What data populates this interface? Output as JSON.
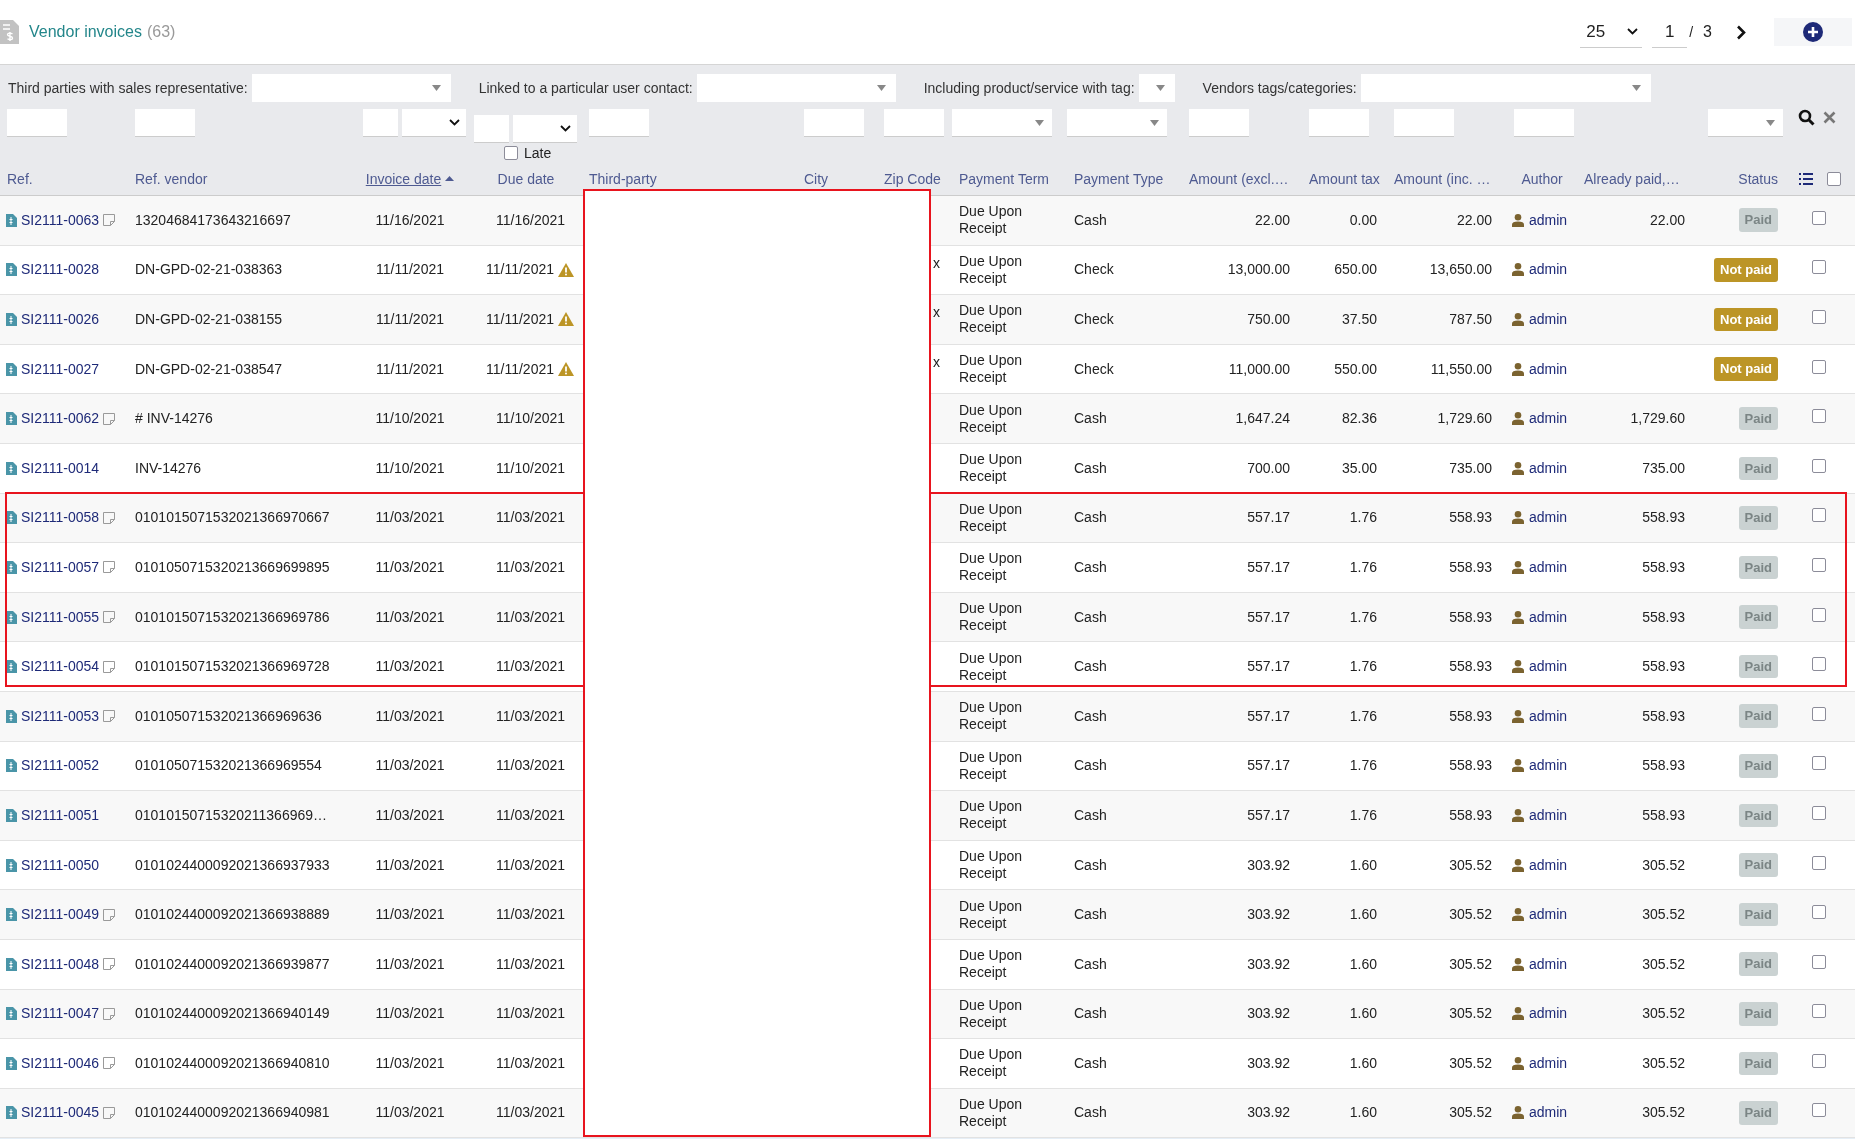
{
  "header": {
    "title": "Vendor invoices",
    "count": "(63)",
    "page_size": "25",
    "page": "1",
    "page_separator": "/",
    "page_total": "3"
  },
  "filters": [
    {
      "label": "Third parties with sales representative:",
      "kind": "wide"
    },
    {
      "label": "Linked to a particular user contact:",
      "kind": "wide"
    },
    {
      "label": "Including product/service with tag:",
      "kind": "narrow"
    },
    {
      "label": "Vendors tags/categories:",
      "kind": "xwide"
    }
  ],
  "column_filters": [
    {
      "kind": "text"
    },
    {
      "kind": "text"
    },
    {
      "kind": "date"
    },
    {
      "kind": "date_late"
    },
    {
      "kind": "text"
    },
    {
      "kind": "text"
    },
    {
      "kind": "text"
    },
    {
      "kind": "select"
    },
    {
      "kind": "select"
    },
    {
      "kind": "text"
    },
    {
      "kind": "text"
    },
    {
      "kind": "text"
    },
    {
      "kind": "text"
    },
    {
      "kind": "none"
    },
    {
      "kind": "select"
    },
    {
      "kind": "actions"
    }
  ],
  "late_filter": {
    "label": "Late",
    "checked": false
  },
  "columns": [
    {
      "label": "Ref.",
      "sorted": false
    },
    {
      "label": "Ref. vendor",
      "sorted": false
    },
    {
      "label": "Invoice date",
      "sorted": true
    },
    {
      "label": "Due date",
      "sorted": false
    },
    {
      "label": "Third-party",
      "sorted": false
    },
    {
      "label": "City",
      "sorted": false
    },
    {
      "label": "Zip Code",
      "sorted": false
    },
    {
      "label": "Payment Term",
      "sorted": false
    },
    {
      "label": "Payment Type",
      "sorted": false
    },
    {
      "label": "Amount (excl.…",
      "sorted": false
    },
    {
      "label": "Amount tax",
      "sorted": false
    },
    {
      "label": "Amount (inc. …",
      "sorted": false
    },
    {
      "label": "Author",
      "sorted": false
    },
    {
      "label": "Already paid,…",
      "sorted": false
    },
    {
      "label": "Status",
      "sorted": false
    }
  ],
  "select_all": {
    "checked": false
  },
  "rows": [
    {
      "ref": "SI2111-0063",
      "note": true,
      "ref_vendor": "13204684173643216697",
      "invoice_date": "11/16/2021",
      "due_date": "11/16/2021",
      "late": false,
      "payment_term": "Due Upon Receipt",
      "payment_type": "Cash",
      "amount_excl": "22.00",
      "amount_tax": "0.00",
      "amount_inc": "22.00",
      "author": "admin",
      "already_paid": "22.00",
      "status": {
        "label": "Paid",
        "kind": "paid"
      },
      "checked": false
    },
    {
      "ref": "SI2111-0028",
      "note": false,
      "ref_vendor": "DN-GPD-02-21-038363",
      "invoice_date": "11/11/2021",
      "due_date": "11/11/2021",
      "late": true,
      "zip_code": "x",
      "payment_term": "Due Upon Receipt",
      "payment_type": "Check",
      "amount_excl": "13,000.00",
      "amount_tax": "650.00",
      "amount_inc": "13,650.00",
      "author": "admin",
      "status": {
        "label": "Not paid",
        "kind": "unpaid"
      },
      "checked": false
    },
    {
      "ref": "SI2111-0026",
      "note": false,
      "ref_vendor": "DN-GPD-02-21-038155",
      "invoice_date": "11/11/2021",
      "due_date": "11/11/2021",
      "late": true,
      "zip_code": "x",
      "payment_term": "Due Upon Receipt",
      "payment_type": "Check",
      "amount_excl": "750.00",
      "amount_tax": "37.50",
      "amount_inc": "787.50",
      "author": "admin",
      "status": {
        "label": "Not paid",
        "kind": "unpaid"
      },
      "checked": false
    },
    {
      "ref": "SI2111-0027",
      "note": false,
      "ref_vendor": "DN-GPD-02-21-038547",
      "invoice_date": "11/11/2021",
      "due_date": "11/11/2021",
      "late": true,
      "zip_code": "x",
      "payment_term": "Due Upon Receipt",
      "payment_type": "Check",
      "amount_excl": "11,000.00",
      "amount_tax": "550.00",
      "amount_inc": "11,550.00",
      "author": "admin",
      "status": {
        "label": "Not paid",
        "kind": "unpaid"
      },
      "checked": false
    },
    {
      "ref": "SI2111-0062",
      "note": true,
      "ref_vendor": "# INV-14276",
      "invoice_date": "11/10/2021",
      "due_date": "11/10/2021",
      "late": false,
      "payment_term": "Due Upon Receipt",
      "payment_type": "Cash",
      "amount_excl": "1,647.24",
      "amount_tax": "82.36",
      "amount_inc": "1,729.60",
      "author": "admin",
      "already_paid": "1,729.60",
      "status": {
        "label": "Paid",
        "kind": "paid"
      },
      "checked": false
    },
    {
      "ref": "SI2111-0014",
      "note": false,
      "ref_vendor": "INV-14276",
      "invoice_date": "11/10/2021",
      "due_date": "11/10/2021",
      "late": false,
      "payment_term": "Due Upon Receipt",
      "payment_type": "Cash",
      "amount_excl": "700.00",
      "amount_tax": "35.00",
      "amount_inc": "735.00",
      "author": "admin",
      "already_paid": "735.00",
      "status": {
        "label": "Paid",
        "kind": "paid"
      },
      "checked": false
    },
    {
      "ref": "SI2111-0058",
      "note": true,
      "ref_vendor": "0101015071532021366970667",
      "invoice_date": "11/03/2021",
      "due_date": "11/03/2021",
      "late": false,
      "payment_term": "Due Upon Receipt",
      "payment_type": "Cash",
      "amount_excl": "557.17",
      "amount_tax": "1.76",
      "amount_inc": "558.93",
      "author": "admin",
      "already_paid": "558.93",
      "status": {
        "label": "Paid",
        "kind": "paid"
      },
      "checked": false
    },
    {
      "ref": "SI2111-0057",
      "note": true,
      "ref_vendor": "0101050715320213669699895",
      "invoice_date": "11/03/2021",
      "due_date": "11/03/2021",
      "late": false,
      "payment_term": "Due Upon Receipt",
      "payment_type": "Cash",
      "amount_excl": "557.17",
      "amount_tax": "1.76",
      "amount_inc": "558.93",
      "author": "admin",
      "already_paid": "558.93",
      "status": {
        "label": "Paid",
        "kind": "paid"
      },
      "checked": false
    },
    {
      "ref": "SI2111-0055",
      "note": true,
      "ref_vendor": "0101015071532021366969786",
      "invoice_date": "11/03/2021",
      "due_date": "11/03/2021",
      "late": false,
      "payment_term": "Due Upon Receipt",
      "payment_type": "Cash",
      "amount_excl": "557.17",
      "amount_tax": "1.76",
      "amount_inc": "558.93",
      "author": "admin",
      "already_paid": "558.93",
      "status": {
        "label": "Paid",
        "kind": "paid"
      },
      "checked": false
    },
    {
      "ref": "SI2111-0054",
      "note": true,
      "ref_vendor": "0101015071532021366969728",
      "invoice_date": "11/03/2021",
      "due_date": "11/03/2021",
      "late": false,
      "payment_term": "Due Upon Receipt",
      "payment_type": "Cash",
      "amount_excl": "557.17",
      "amount_tax": "1.76",
      "amount_inc": "558.93",
      "author": "admin",
      "already_paid": "558.93",
      "status": {
        "label": "Paid",
        "kind": "paid"
      },
      "checked": false
    },
    {
      "ref": "SI2111-0053",
      "note": true,
      "ref_vendor": "010105071532021366969636",
      "invoice_date": "11/03/2021",
      "due_date": "11/03/2021",
      "late": false,
      "payment_term": "Due Upon Receipt",
      "payment_type": "Cash",
      "amount_excl": "557.17",
      "amount_tax": "1.76",
      "amount_inc": "558.93",
      "author": "admin",
      "already_paid": "558.93",
      "status": {
        "label": "Paid",
        "kind": "paid"
      },
      "checked": false
    },
    {
      "ref": "SI2111-0052",
      "note": false,
      "ref_vendor": "010105071532021366969554",
      "invoice_date": "11/03/2021",
      "due_date": "11/03/2021",
      "late": false,
      "payment_term": "Due Upon Receipt",
      "payment_type": "Cash",
      "amount_excl": "557.17",
      "amount_tax": "1.76",
      "amount_inc": "558.93",
      "author": "admin",
      "already_paid": "558.93",
      "status": {
        "label": "Paid",
        "kind": "paid"
      },
      "checked": false
    },
    {
      "ref": "SI2111-0051",
      "note": false,
      "ref_vendor": "01010150715320211366969…",
      "invoice_date": "11/03/2021",
      "due_date": "11/03/2021",
      "late": false,
      "payment_term": "Due Upon Receipt",
      "payment_type": "Cash",
      "amount_excl": "557.17",
      "amount_tax": "1.76",
      "amount_inc": "558.93",
      "author": "admin",
      "already_paid": "558.93",
      "status": {
        "label": "Paid",
        "kind": "paid"
      },
      "checked": false
    },
    {
      "ref": "SI2111-0050",
      "note": false,
      "ref_vendor": "0101024400092021366937933",
      "invoice_date": "11/03/2021",
      "due_date": "11/03/2021",
      "late": false,
      "payment_term": "Due Upon Receipt",
      "payment_type": "Cash",
      "amount_excl": "303.92",
      "amount_tax": "1.60",
      "amount_inc": "305.52",
      "author": "admin",
      "already_paid": "305.52",
      "status": {
        "label": "Paid",
        "kind": "paid"
      },
      "checked": false
    },
    {
      "ref": "SI2111-0049",
      "note": true,
      "ref_vendor": "0101024400092021366938889",
      "invoice_date": "11/03/2021",
      "due_date": "11/03/2021",
      "late": false,
      "payment_term": "Due Upon Receipt",
      "payment_type": "Cash",
      "amount_excl": "303.92",
      "amount_tax": "1.60",
      "amount_inc": "305.52",
      "author": "admin",
      "already_paid": "305.52",
      "status": {
        "label": "Paid",
        "kind": "paid"
      },
      "checked": false
    },
    {
      "ref": "SI2111-0048",
      "note": true,
      "ref_vendor": "0101024400092021366939877",
      "invoice_date": "11/03/2021",
      "due_date": "11/03/2021",
      "late": false,
      "payment_term": "Due Upon Receipt",
      "payment_type": "Cash",
      "amount_excl": "303.92",
      "amount_tax": "1.60",
      "amount_inc": "305.52",
      "author": "admin",
      "already_paid": "305.52",
      "status": {
        "label": "Paid",
        "kind": "paid"
      },
      "checked": false
    },
    {
      "ref": "SI2111-0047",
      "note": true,
      "ref_vendor": "0101024400092021366940149",
      "invoice_date": "11/03/2021",
      "due_date": "11/03/2021",
      "late": false,
      "payment_term": "Due Upon Receipt",
      "payment_type": "Cash",
      "amount_excl": "303.92",
      "amount_tax": "1.60",
      "amount_inc": "305.52",
      "author": "admin",
      "already_paid": "305.52",
      "status": {
        "label": "Paid",
        "kind": "paid"
      },
      "checked": false
    },
    {
      "ref": "SI2111-0046",
      "note": true,
      "ref_vendor": "0101024400092021366940810",
      "invoice_date": "11/03/2021",
      "due_date": "11/03/2021",
      "late": false,
      "payment_term": "Due Upon Receipt",
      "payment_type": "Cash",
      "amount_excl": "303.92",
      "amount_tax": "1.60",
      "amount_inc": "305.52",
      "author": "admin",
      "already_paid": "305.52",
      "status": {
        "label": "Paid",
        "kind": "paid"
      },
      "checked": false
    },
    {
      "ref": "SI2111-0045",
      "note": true,
      "ref_vendor": "0101024400092021366940981",
      "invoice_date": "11/03/2021",
      "due_date": "11/03/2021",
      "late": false,
      "payment_term": "Due Upon Receipt",
      "payment_type": "Cash",
      "amount_excl": "303.92",
      "amount_tax": "1.60",
      "amount_inc": "305.52",
      "author": "admin",
      "already_paid": "305.52",
      "status": {
        "label": "Paid",
        "kind": "paid"
      },
      "checked": false
    }
  ]
}
